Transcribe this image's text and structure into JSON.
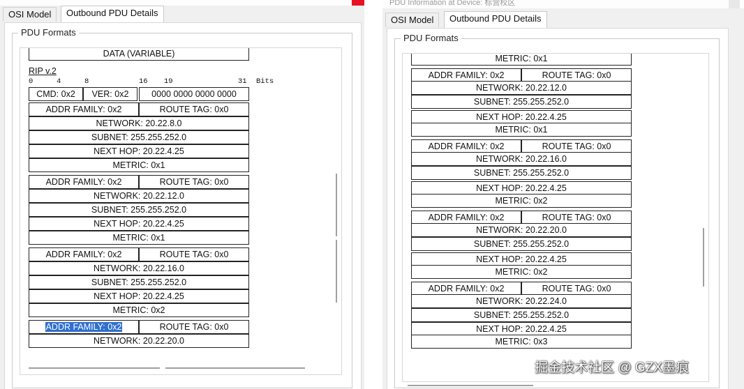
{
  "left": {
    "tabs": [
      "OSI Model",
      "Outbound PDU Details"
    ],
    "group_title": "PDU Formats",
    "data_label": "DATA (VARIABLE)",
    "rip_title": "RIP v.2",
    "bits": [
      "0",
      "4",
      "8",
      "16",
      "19",
      "31",
      "Bits"
    ],
    "header": {
      "cmd": "CMD: 0x2",
      "ver": "VER: 0x2",
      "zero": "0000 0000 0000 0000"
    },
    "entries": [
      {
        "addr": "ADDR FAMILY: 0x2",
        "tag": "ROUTE TAG: 0x0",
        "network": "NETWORK: 20.22.8.0",
        "subnet": "SUBNET: 255.255.252.0",
        "nexthop": "NEXT HOP: 20.22.4.25",
        "metric": "METRIC: 0x1"
      },
      {
        "addr": "ADDR FAMILY: 0x2",
        "tag": "ROUTE TAG: 0x0",
        "network": "NETWORK: 20.22.12.0",
        "subnet": "SUBNET: 255.255.252.0",
        "nexthop": "NEXT HOP: 20.22.4.25",
        "metric": "METRIC: 0x1"
      },
      {
        "addr": "ADDR FAMILY: 0x2",
        "tag": "ROUTE TAG: 0x0",
        "network": "NETWORK: 20.22.16.0",
        "subnet": "SUBNET: 255.255.252.0",
        "nexthop": "NEXT HOP: 20.22.4.25",
        "metric": "METRIC: 0x2"
      }
    ],
    "partial_entry": {
      "addr": "ADDR FAMILY: 0x2",
      "tag": "ROUTE TAG: 0x0",
      "network": "NETWORK: 20.22.20.0"
    }
  },
  "right": {
    "window_title": "PDU Information at Device: 标营校区",
    "tabs": [
      "OSI Model",
      "Outbound PDU Details"
    ],
    "group_title": "PDU Formats",
    "top_metric": "METRIC: 0x1",
    "entries": [
      {
        "addr": "ADDR FAMILY: 0x2",
        "tag": "ROUTE TAG: 0x0",
        "network": "NETWORK: 20.22.12.0",
        "subnet": "SUBNET: 255.255.252.0",
        "nexthop": "NEXT HOP: 20.22.4.25",
        "metric": "METRIC: 0x1"
      },
      {
        "addr": "ADDR FAMILY: 0x2",
        "tag": "ROUTE TAG: 0x0",
        "network": "NETWORK: 20.22.16.0",
        "subnet": "SUBNET: 255.255.252.0",
        "nexthop": "NEXT HOP: 20.22.4.25",
        "metric": "METRIC: 0x2"
      },
      {
        "addr": "ADDR FAMILY: 0x2",
        "tag": "ROUTE TAG: 0x0",
        "network": "NETWORK: 20.22.20.0",
        "subnet": "SUBNET: 255.255.252.0",
        "nexthop": "NEXT HOP: 20.22.4.25",
        "metric": "METRIC: 0x2"
      },
      {
        "addr": "ADDR FAMILY: 0x2",
        "tag": "ROUTE TAG: 0x0",
        "network": "NETWORK: 20.22.24.0",
        "subnet": "SUBNET: 255.255.252.0",
        "nexthop": "NEXT HOP: 20.22.4.25",
        "metric": "METRIC: 0x3"
      }
    ]
  },
  "watermark": "掘金技术社区 @ GZX墨痕",
  "colors": {
    "selection": "#2f6fce",
    "close_button": "#e81123"
  }
}
